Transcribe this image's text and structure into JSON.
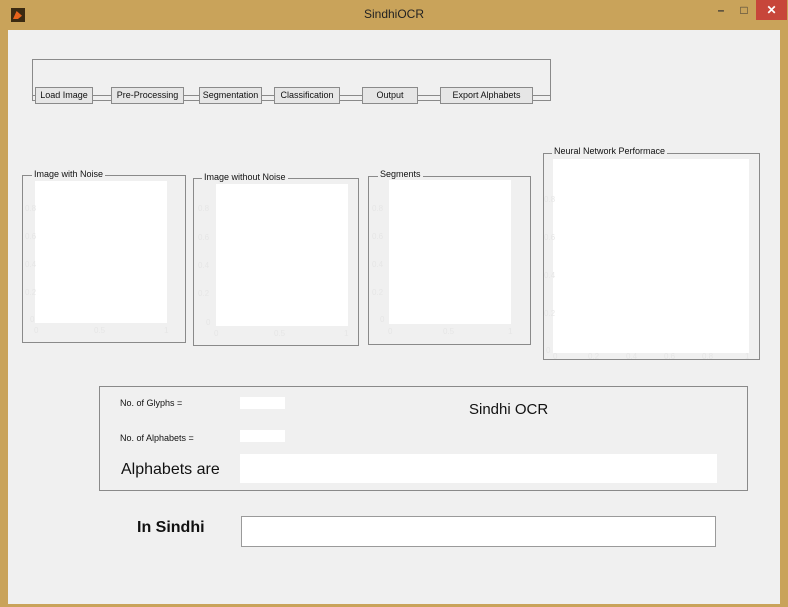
{
  "window": {
    "title": "SindhiOCR",
    "minimize": "–",
    "maximize": "□",
    "close": "✕"
  },
  "toolbar": {
    "buttons": [
      "Load Image",
      "Pre-Processing",
      "Segmentation",
      "Classification",
      "Output",
      "Export Alphabets"
    ]
  },
  "plots": [
    {
      "label": "Image with Noise",
      "yticks": [
        "0.8",
        "0.6",
        "0.4",
        "0.2",
        "0"
      ],
      "xticks": [
        "0",
        "0.5",
        "1"
      ]
    },
    {
      "label": "Image without Noise",
      "yticks": [
        "0.8",
        "0.6",
        "0.4",
        "0.2",
        "0"
      ],
      "xticks": [
        "0",
        "0.5",
        "1"
      ]
    },
    {
      "label": "Segments",
      "yticks": [
        "0.8",
        "0.6",
        "0.4",
        "0.2",
        "0"
      ],
      "xticks": [
        "0",
        "0.5",
        "1"
      ]
    },
    {
      "label": "Neural Network Performace",
      "yticks": [
        "0.8",
        "0.6",
        "0.4",
        "0.2",
        "0"
      ],
      "xticks": [
        "0",
        "0.2",
        "0.4",
        "0.6",
        "0.8",
        "1"
      ]
    }
  ],
  "results": {
    "glyphs_label": "No. of Glyphs =",
    "glyphs_value": "",
    "alphabets_count_label": "No. of Alphabets =",
    "alphabets_count_value": "",
    "heading": "Sindhi OCR",
    "alphabets_label": "Alphabets are",
    "alphabets_value": ""
  },
  "sindhi": {
    "label": "In Sindhi",
    "value": ""
  }
}
